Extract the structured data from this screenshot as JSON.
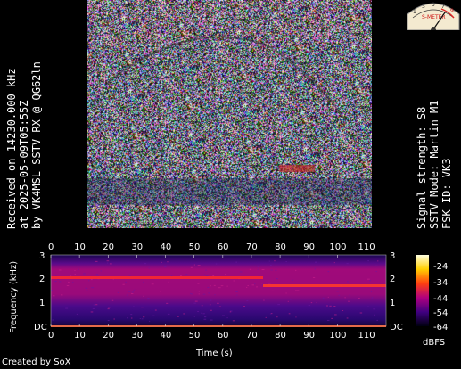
{
  "caption_left": {
    "line1": "Received on  14230.000 kHz",
    "line2": "at 2025-05-09T05:55Z",
    "line3": "by VK4MSL SSTV RX @ QG62ln"
  },
  "caption_right": {
    "line1": "Signal strength: S8",
    "line2": "SSTV Mode: Martin M1",
    "line3": "FSK ID: VK3"
  },
  "s_meter": {
    "scale_label": "S-METER",
    "scale_digits": [
      "1",
      "3",
      "5",
      "7",
      "9"
    ]
  },
  "spectrogram": {
    "ylabel": "Frequency (kHz)",
    "xlabel": "Time (s)",
    "y_ticks": [
      "3",
      "2",
      "1",
      "DC"
    ],
    "x_ticks": [
      "0",
      "10",
      "20",
      "30",
      "40",
      "50",
      "60",
      "70",
      "80",
      "90",
      "100",
      "110"
    ],
    "colorbar_ticks": [
      "-24",
      "-34",
      "-44",
      "-54",
      "-64"
    ],
    "colorbar_unit": "dBFS",
    "colors": {
      "bg": "#3a0a78",
      "band": "#9a0a7a",
      "trace": "#ff3030"
    }
  },
  "credit": "Created by SoX"
}
